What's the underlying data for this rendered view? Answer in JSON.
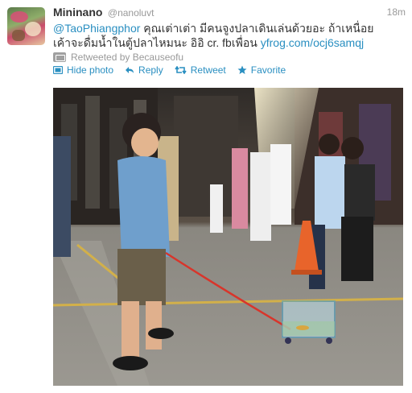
{
  "tweet": {
    "fullname": "Mininano",
    "username": "@nanoluvt",
    "time": "18m",
    "mention": "@TaoPhiangphor",
    "text_main": " คุณเต่าเต่า มีคนจูงปลาเดินเล่นด้วยอะ ถ้าเหนื่อยเค้าจะดื่มน้ำในตู้ปลาไหมนะ อิอิ cr. fbเพื่อน ",
    "url": "yfrog.com/ocj6samqj",
    "retweeted_by": "Retweeted by Becauseofu"
  },
  "actions": {
    "hide_photo": "Hide photo",
    "reply": "Reply",
    "retweet": "Retweet",
    "favorite": "Favorite"
  },
  "colors": {
    "link": "#2a8fc1",
    "muted": "#999999",
    "text": "#333333"
  }
}
